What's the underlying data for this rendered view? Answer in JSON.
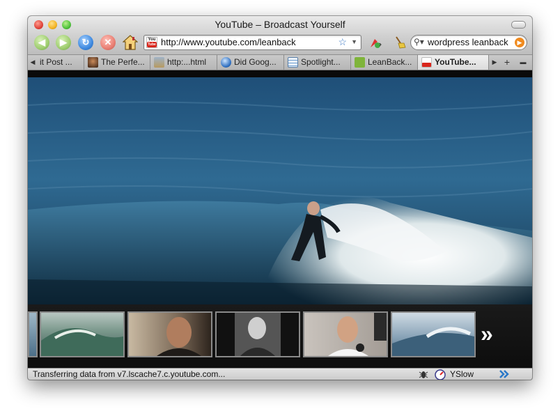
{
  "window": {
    "title": "YouTube – Broadcast Yourself"
  },
  "toolbar": {
    "url": "http://www.youtube.com/leanback",
    "search_query": "wordpress leanback"
  },
  "tabs": [
    {
      "label": "it Post ...",
      "icon": "none",
      "active": false
    },
    {
      "label": "The Perfe...",
      "icon": "portrait-favicon",
      "active": false
    },
    {
      "label": "http:...html",
      "icon": "image-favicon",
      "active": false
    },
    {
      "label": "Did Goog...",
      "icon": "globe-favicon",
      "active": false
    },
    {
      "label": "Spotlight...",
      "icon": "spotlight-favicon",
      "active": false
    },
    {
      "label": "LeanBack...",
      "icon": "green-favicon",
      "active": false
    },
    {
      "label": "YouTube...",
      "icon": "youtube-favicon",
      "active": true
    }
  ],
  "player": {
    "next_label": "»",
    "thumbnails": [
      {
        "name": "partial-thumb"
      },
      {
        "name": "surf-wave-thumb"
      },
      {
        "name": "surfer-interview-thumb"
      },
      {
        "name": "bw-portrait-thumb"
      },
      {
        "name": "interview-mic-thumb"
      },
      {
        "name": "wave-barrel-thumb"
      }
    ]
  },
  "status": {
    "text": "Transferring data from v7.lscache7.c.youtube.com...",
    "yslow": "YSlow"
  },
  "colors": {
    "youtube_red": "#d9261c",
    "accent_blue": "#3f8ae0",
    "search_go": "#f08a1e"
  }
}
